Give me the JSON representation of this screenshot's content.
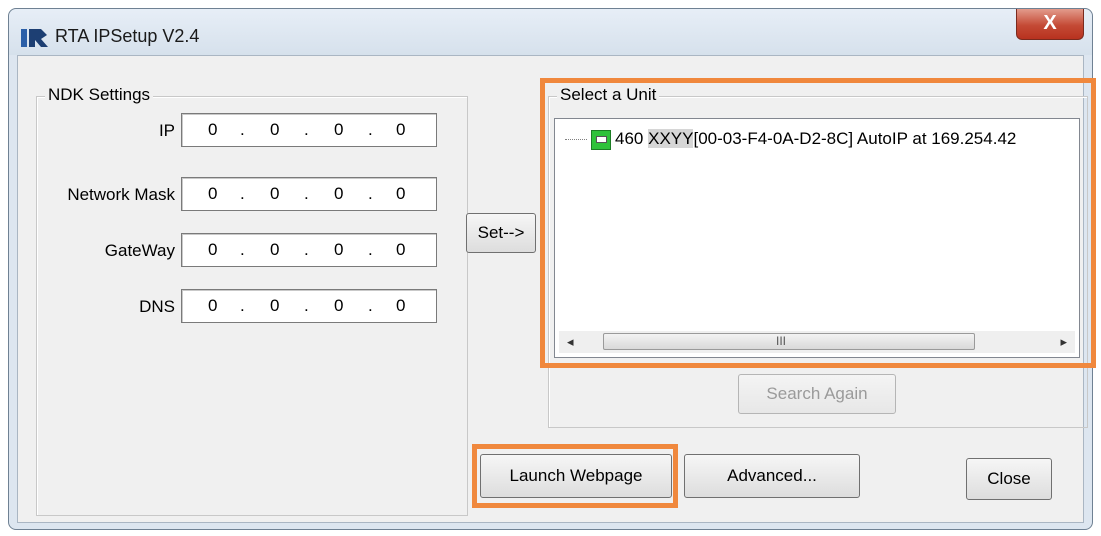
{
  "window": {
    "title": "RTA IPSetup V2.4",
    "close_glyph": "X",
    "accent_highlight": "#f0883d"
  },
  "ndk": {
    "group_label": "NDK Settings",
    "fields": [
      {
        "label": "IP",
        "octets": [
          "0",
          "0",
          "0",
          "0"
        ]
      },
      {
        "label": "Network Mask",
        "octets": [
          "0",
          "0",
          "0",
          "0"
        ]
      },
      {
        "label": "GateWay",
        "octets": [
          "0",
          "0",
          "0",
          "0"
        ]
      },
      {
        "label": "DNS",
        "octets": [
          "0",
          "0",
          "0",
          "0"
        ]
      }
    ],
    "dot": "."
  },
  "set_button": "Set-->",
  "unit": {
    "group_label": "Select a Unit",
    "items": [
      {
        "model": "460",
        "masked": "XXYY",
        "detail": "[00-03-F4-0A-D2-8C] AutoIP at 169.254.42",
        "icon": "network-device-icon"
      }
    ],
    "scroll_grip": "III",
    "scroll_left": "◂",
    "scroll_right": "▸",
    "search_again": "Search Again"
  },
  "buttons": {
    "launch_webpage": "Launch Webpage",
    "advanced": "Advanced...",
    "close": "Close"
  }
}
